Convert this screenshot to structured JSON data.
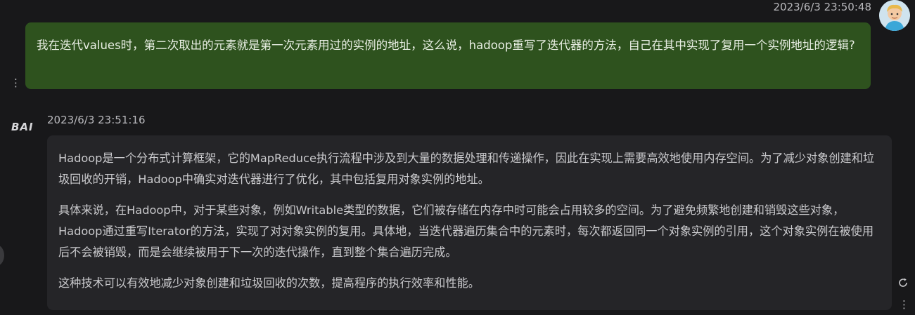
{
  "user_message": {
    "timestamp": "2023/6/3 23:50:48",
    "text": "我在迭代values时，第二次取出的元素就是第一次元素用过的实例的地址，这么说，hadoop重写了迭代器的方法，自己在其中实现了复用一个实例地址的逻辑?",
    "avatar_icon": "user-avatar-icon"
  },
  "bot_message": {
    "logo_text": "BAI",
    "timestamp": "2023/6/3 23:51:16",
    "paragraphs": [
      "Hadoop是一个分布式计算框架，它的MapReduce执行流程中涉及到大量的数据处理和传递操作，因此在实现上需要高效地使用内存空间。为了减少对象创建和垃圾回收的开销，Hadoop中确实对迭代器进行了优化，其中包括复用对象实例的地址。",
      "具体来说，在Hadoop中，对于某些对象，例如Writable类型的数据，它们被存储在内存中时可能会占用较多的空间。为了避免频繁地创建和销毁这些对象，Hadoop通过重写Iterator的方法，实现了对对象实例的复用。具体地，当迭代器遍历集合中的元素时，每次都返回同一个对象实例的引用，这个对象实例在被使用后不会被销毁，而是会继续被用于下一次的迭代操作，直到整个集合遍历完成。",
      "这种技术可以有效地减少对象创建和垃圾回收的次数，提高程序的执行效率和性能。"
    ]
  },
  "colors": {
    "background": "#18181a",
    "user_bubble": "#2e521e",
    "bot_bubble": "#252528"
  },
  "icons": {
    "more": "kebab-menu-icon",
    "regenerate": "refresh-icon"
  }
}
